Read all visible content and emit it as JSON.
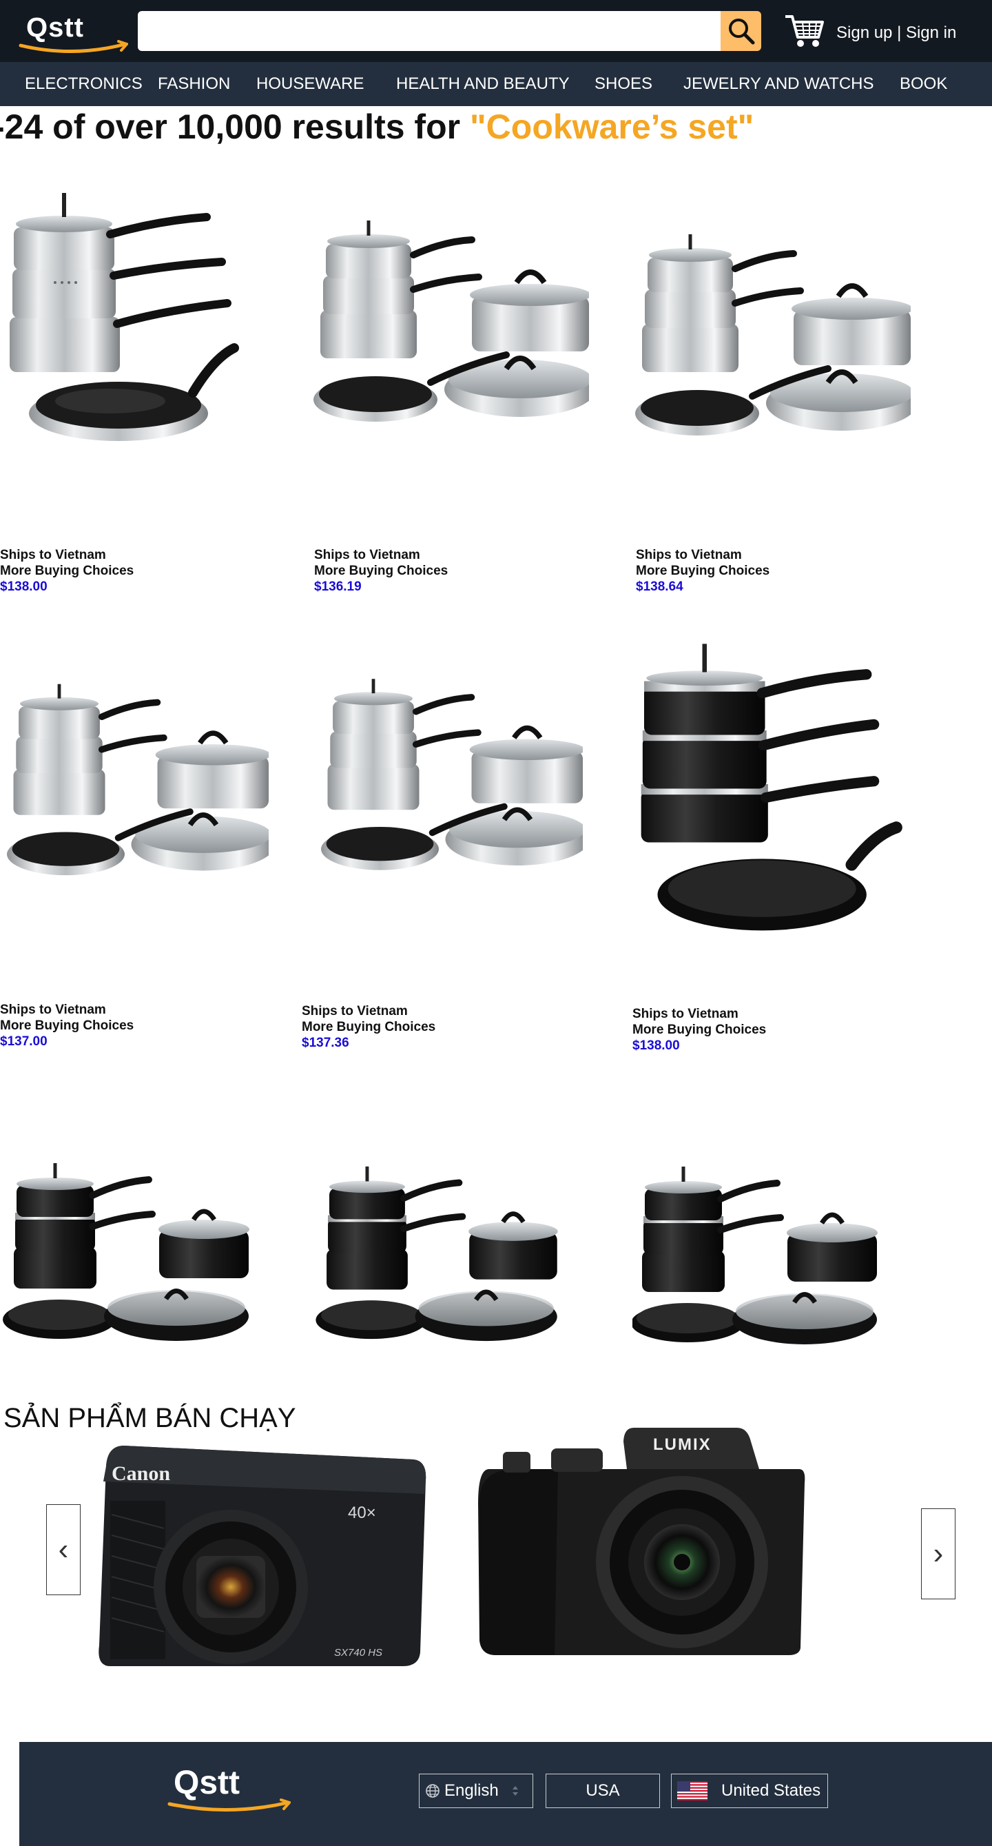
{
  "header": {
    "logo": "Qstt",
    "search_placeholder": "",
    "search_icon": "search-icon",
    "cart_icon": "cart-icon",
    "auth_text": "Sign up | Sign in"
  },
  "nav": {
    "items": [
      "ELECTRONICS",
      "FASHION",
      "HOUSEWARE",
      "HEALTH AND BEAUTY",
      "SHOES",
      "JEWELRY AND WATCHS",
      "BOOK"
    ]
  },
  "results": {
    "prefix": "-24 of over 10,000 results for ",
    "query": "\"Cookware’s set\""
  },
  "products": [
    {
      "ships": "Ships to Vietnam",
      "more": "More Buying Choices",
      "price": "$138.00"
    },
    {
      "ships": "Ships to Vietnam",
      "more": "More Buying Choices",
      "price": "$136.19"
    },
    {
      "ships": "Ships to Vietnam",
      "more": "More Buying Choices",
      "price": "$138.64"
    },
    {
      "ships": "Ships to Vietnam",
      "more": "More Buying Choices",
      "price": "$137.00"
    },
    {
      "ships": "Ships to Vietnam",
      "more": "More Buying Choices",
      "price": "$137.36"
    },
    {
      "ships": "Ships to Vietnam",
      "more": "More Buying Choices",
      "price": "$138.00"
    }
  ],
  "best_sellers": {
    "title": "SẢN PHẨM BÁN CHẠY",
    "prev": "‹",
    "next": "›",
    "camera1_brand": "Canon",
    "camera1_model": "SX740 HS",
    "camera1_zoom": "40×",
    "camera2_brand": "LUMIX"
  },
  "footer": {
    "logo": "Qstt",
    "language": "English",
    "country_code": "USA",
    "country": "United States"
  },
  "colors": {
    "header_bg": "#131921",
    "nav_bg": "#232f3e",
    "accent": "#febd69",
    "query": "#f5a623",
    "price": "#1a0dd6"
  }
}
